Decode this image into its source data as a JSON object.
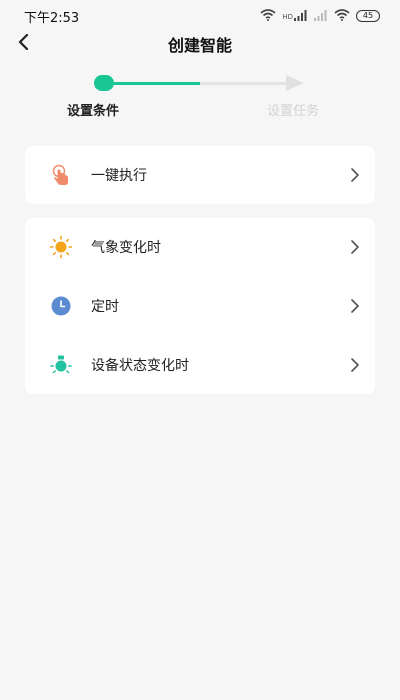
{
  "status_bar": {
    "time": "下午2:53",
    "hd_label": "HD",
    "battery": "45",
    "icons": [
      "wifi-icon",
      "signal-icon",
      "signal-weak-icon",
      "wifi-icon",
      "battery-icon"
    ]
  },
  "header": {
    "title": "创建智能",
    "back_icon": "chevron-left-icon"
  },
  "stepper": {
    "steps": [
      {
        "label": "设置条件",
        "active": true
      },
      {
        "label": "设置任务",
        "active": false
      }
    ],
    "accent": "#19c694",
    "inactive_color": "#e3e3e3"
  },
  "sections": [
    {
      "items": [
        {
          "label": "一键执行",
          "icon": "tap-hand-icon",
          "icon_color": "#ef8b6a"
        }
      ]
    },
    {
      "items": [
        {
          "label": "气象变化时",
          "icon": "sun-icon",
          "icon_color": "#f4a51c"
        },
        {
          "label": "定时",
          "icon": "clock-icon",
          "icon_color": "#5b8bd1"
        },
        {
          "label": "设备状态变化时",
          "icon": "device-icon",
          "icon_color": "#23c2a1"
        }
      ]
    }
  ]
}
